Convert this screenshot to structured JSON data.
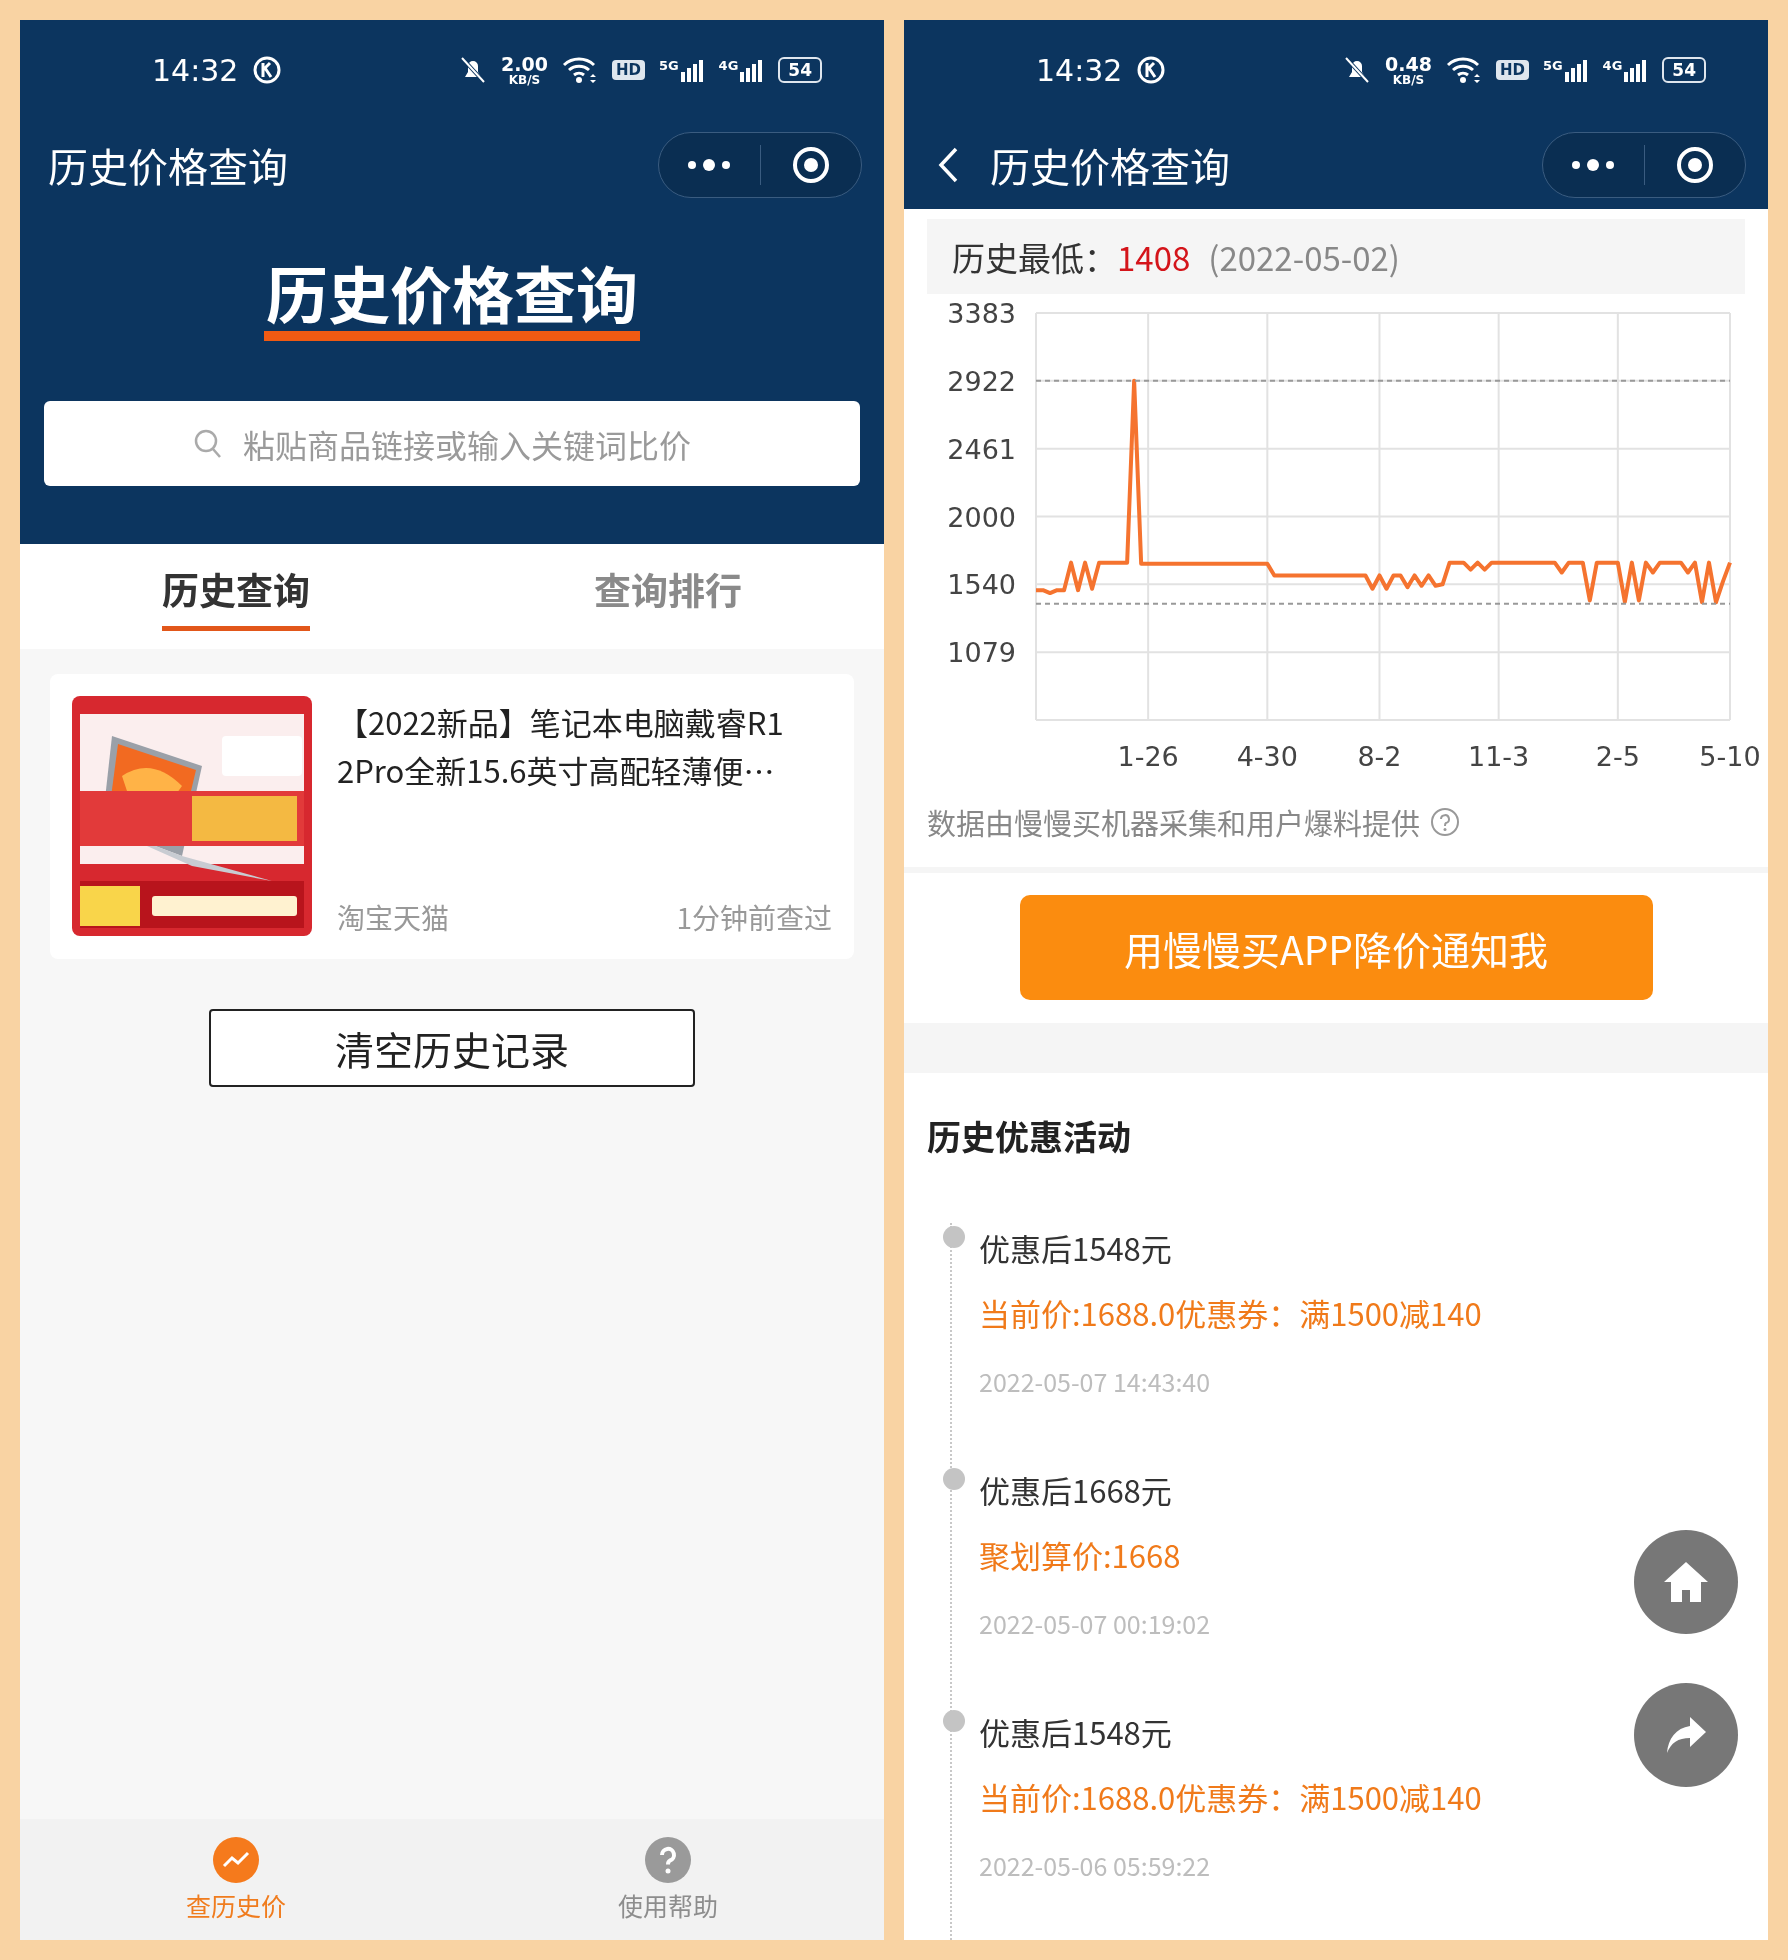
{
  "left_screen": {
    "status_bar": {
      "time": "14:32",
      "speed": "2.00",
      "speed_unit": "KB/S",
      "hd": "HD",
      "signals": [
        "5G",
        "4G"
      ],
      "battery": "54"
    },
    "header": {
      "title": "历史价格查询"
    },
    "banner": {
      "title": "历史价格查询"
    },
    "search": {
      "placeholder": "粘贴商品链接或输入关键词比价"
    },
    "tabs": [
      {
        "label": "历史查询",
        "selected": true
      },
      {
        "label": "查询排行",
        "selected": false
      }
    ],
    "history_items": [
      {
        "kind": "picture",
        "title": "【2022新品】笔记本电脑戴睿R12Pro全新15.6英寸高配轻薄便…",
        "source": "淘宝天猫",
        "time": "1分钟前查过"
      }
    ],
    "clear_button": "清空历史记录",
    "bottom_nav": [
      {
        "kind": "chart",
        "label": "查历史价",
        "selected": true
      },
      {
        "kind": "help",
        "label": "使用帮助",
        "selected": false
      }
    ]
  },
  "right_screen": {
    "status_bar": {
      "time": "14:32",
      "speed": "0.48",
      "speed_unit": "KB/S",
      "hd": "HD",
      "signals": [
        "5G",
        "4G"
      ],
      "battery": "54"
    },
    "header": {
      "title": "历史价格查询"
    },
    "lowest": {
      "label": "历史最低：",
      "price": "1408",
      "date": "(2022-05-02)"
    },
    "chart_data": {
      "type": "line",
      "ylim": [
        618,
        3383
      ],
      "yticks": [
        1079,
        1540,
        2000,
        2461,
        2922,
        3383
      ],
      "grid": true,
      "categories": [
        null,
        null,
        null,
        null,
        null,
        null,
        null,
        null,
        null,
        null,
        null,
        null,
        null,
        null,
        null,
        null,
        "1-26",
        null,
        null,
        null,
        null,
        null,
        null,
        null,
        null,
        null,
        null,
        null,
        null,
        null,
        null,
        null,
        null,
        "4-30",
        null,
        null,
        null,
        null,
        null,
        null,
        null,
        null,
        null,
        null,
        null,
        null,
        null,
        null,
        null,
        "8-2",
        null,
        null,
        null,
        null,
        null,
        null,
        null,
        null,
        null,
        null,
        null,
        null,
        null,
        null,
        null,
        null,
        "11-3",
        null,
        null,
        null,
        null,
        null,
        null,
        null,
        null,
        null,
        null,
        null,
        null,
        null,
        null,
        null,
        null,
        "2-5",
        null,
        null,
        null,
        null,
        null,
        null,
        null,
        null,
        null,
        null,
        null,
        null,
        null,
        null,
        null,
        "5-10"
      ],
      "series": [
        {
          "color": "#f5732f",
          "values": [
            1500,
            1500,
            1480,
            1500,
            1500,
            1687,
            1500,
            1687,
            1510,
            1687,
            1687,
            1687,
            1687,
            1687,
            2922,
            1680,
            1680,
            1680,
            1680,
            1680,
            1680,
            1680,
            1680,
            1680,
            1680,
            1680,
            1680,
            1680,
            1680,
            1680,
            1680,
            1680,
            1680,
            1680,
            1600,
            1600,
            1600,
            1600,
            1600,
            1600,
            1600,
            1600,
            1600,
            1600,
            1600,
            1600,
            1600,
            1600,
            1510,
            1600,
            1510,
            1600,
            1600,
            1520,
            1600,
            1530,
            1600,
            1530,
            1540,
            1687,
            1687,
            1687,
            1640,
            1687,
            1640,
            1687,
            1687,
            1687,
            1687,
            1687,
            1687,
            1687,
            1687,
            1687,
            1687,
            1620,
            1687,
            1687,
            1687,
            1430,
            1687,
            1687,
            1687,
            1687,
            1420,
            1687,
            1430,
            1687,
            1620,
            1687,
            1687,
            1687,
            1687,
            1620,
            1687,
            1418,
            1687,
            1418,
            1560,
            1687
          ]
        },
        {
          "color": "#999999",
          "line_style": "dashed",
          "values": [
            2922,
            2922,
            2922,
            2922,
            2922,
            2922,
            2922,
            2922,
            2922,
            2922,
            2922,
            2922,
            2922,
            2922,
            2922,
            2922,
            2922,
            2922,
            2922,
            2922,
            2922,
            2922,
            2922,
            2922,
            2922,
            2922,
            2922,
            2922,
            2922,
            2922,
            2922,
            2922,
            2922,
            2922,
            2922,
            2922,
            2922,
            2922,
            2922,
            2922,
            2922,
            2922,
            2922,
            2922,
            2922,
            2922,
            2922,
            2922,
            2922,
            2922,
            2922,
            2922,
            2922,
            2922,
            2922,
            2922,
            2922,
            2922,
            2922,
            2922,
            2922,
            2922,
            2922,
            2922,
            2922,
            2922,
            2922,
            2922,
            2922,
            2922,
            2922,
            2922,
            2922,
            2922,
            2922,
            2922,
            2922,
            2922,
            2922,
            2922,
            2922,
            2922,
            2922,
            2922,
            2922,
            2922,
            2922,
            2922,
            2922,
            2922,
            2922,
            2922,
            2922,
            2922,
            2922,
            2922,
            2922,
            2922,
            2922,
            2922
          ]
        },
        {
          "color": "#999999",
          "line_style": "dashed",
          "values": [
            1408,
            1408,
            1408,
            1408,
            1408,
            1408,
            1408,
            1408,
            1408,
            1408,
            1408,
            1408,
            1408,
            1408,
            1408,
            1408,
            1408,
            1408,
            1408,
            1408,
            1408,
            1408,
            1408,
            1408,
            1408,
            1408,
            1408,
            1408,
            1408,
            1408,
            1408,
            1408,
            1408,
            1408,
            1408,
            1408,
            1408,
            1408,
            1408,
            1408,
            1408,
            1408,
            1408,
            1408,
            1408,
            1408,
            1408,
            1408,
            1408,
            1408,
            1408,
            1408,
            1408,
            1408,
            1408,
            1408,
            1408,
            1408,
            1408,
            1408,
            1408,
            1408,
            1408,
            1408,
            1408,
            1408,
            1408,
            1408,
            1408,
            1408,
            1408,
            1408,
            1408,
            1408,
            1408,
            1408,
            1408,
            1408,
            1408,
            1408,
            1408,
            1408,
            1408,
            1408,
            1408,
            1408,
            1408,
            1408,
            1408,
            1408,
            1408,
            1408,
            1408,
            1408,
            1408,
            1408,
            1408,
            1408,
            1408,
            1408
          ]
        }
      ]
    },
    "note": "数据由慢慢买机器采集和用户爆料提供",
    "notify_button": "用慢慢买APP降价通知我",
    "promotions": {
      "title": "历史优惠活动",
      "items": [
        {
          "title": "优惠后1548元",
          "detail": "当前价:1688.0优惠券：满1500减140",
          "time": "2022-05-07 14:43:40"
        },
        {
          "title": "优惠后1668元",
          "detail": "聚划算价:1668",
          "time": "2022-05-07 00:19:02"
        },
        {
          "title": "优惠后1548元",
          "detail": "当前价:1688.0优惠券：满1500减140",
          "time": "2022-05-06 05:59:22"
        }
      ]
    }
  }
}
